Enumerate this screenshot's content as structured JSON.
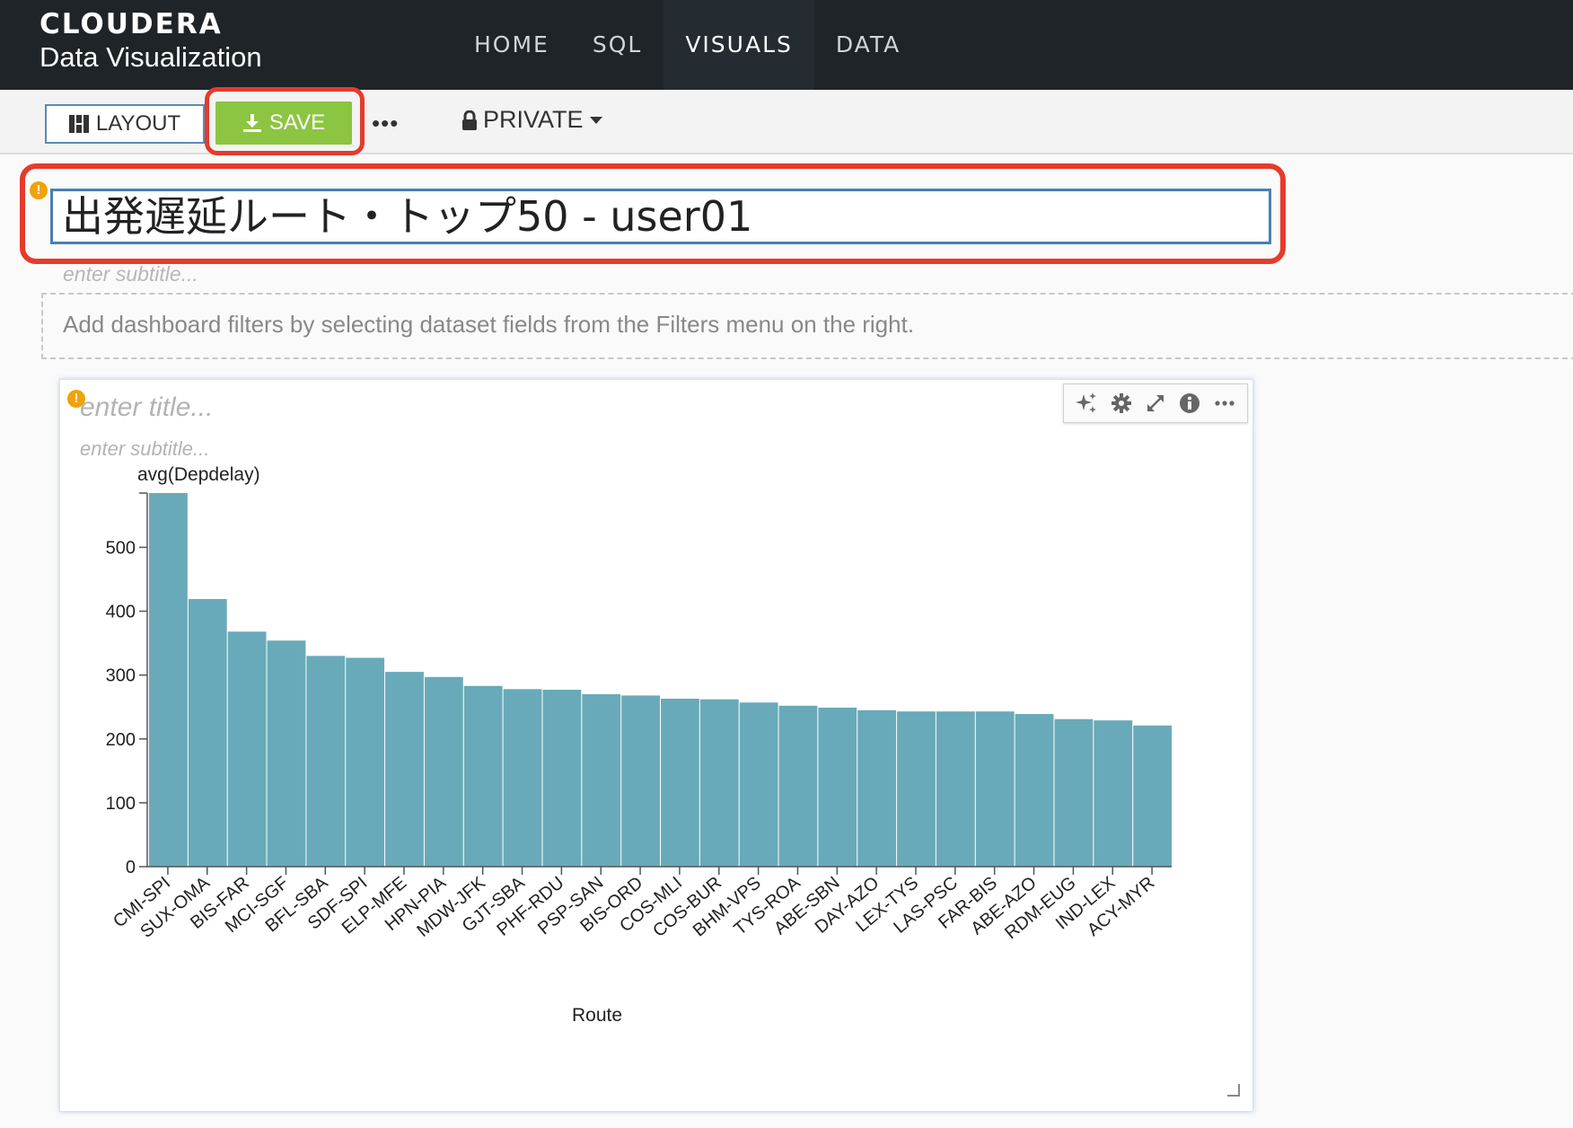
{
  "brand": {
    "logo": "CLOUDERA",
    "product": "Data Visualization"
  },
  "nav": {
    "tabs": [
      "HOME",
      "SQL",
      "VISUALS",
      "DATA"
    ],
    "active": "VISUALS"
  },
  "toolbar": {
    "layout_label": "LAYOUT",
    "save_label": "SAVE",
    "more_label": "•••",
    "privacy_label": "PRIVATE"
  },
  "dashboard": {
    "title": "出発遅延ルート・トップ50 - user01",
    "subtitle_placeholder": "enter subtitle...",
    "filters_hint": "Add dashboard filters by selecting dataset fields from the Filters menu on the right."
  },
  "visual": {
    "title_placeholder": "enter title...",
    "subtitle_placeholder": "enter subtitle...",
    "tools": [
      "sparkle-icon",
      "gear-icon",
      "expand-icon",
      "info-icon",
      "more-icon"
    ]
  },
  "colors": {
    "bar": "#68aab9",
    "highlight": "#e53b2c",
    "save": "#8cc541",
    "topbar": "#1e2428",
    "accent": "#3d94d0"
  },
  "chart_data": {
    "type": "bar",
    "title": "",
    "xlabel": "Route",
    "ylabel": "avg(Depdelay)",
    "ylim": [
      0,
      585
    ],
    "yticks": [
      0,
      100,
      200,
      300,
      400,
      500
    ],
    "categories": [
      "CMI-SPI",
      "SUX-OMA",
      "BIS-FAR",
      "MCI-SGF",
      "BFL-SBA",
      "SDF-SPI",
      "ELP-MFE",
      "HPN-PIA",
      "MDW-JFK",
      "GJT-SBA",
      "PHF-RDU",
      "PSP-SAN",
      "BIS-ORD",
      "COS-MLI",
      "COS-BUR",
      "BHM-VPS",
      "TYS-ROA",
      "ABE-SBN",
      "DAY-AZO",
      "LEX-TYS",
      "LAS-PSC",
      "FAR-BIS",
      "ABE-AZO",
      "RDM-EUG",
      "IND-LEX",
      "ACY-MYR"
    ],
    "values": [
      585,
      419,
      368,
      354,
      330,
      327,
      305,
      297,
      283,
      278,
      277,
      270,
      268,
      263,
      262,
      257,
      252,
      249,
      245,
      243,
      243,
      243,
      239,
      231,
      229,
      221
    ],
    "grid": false
  }
}
